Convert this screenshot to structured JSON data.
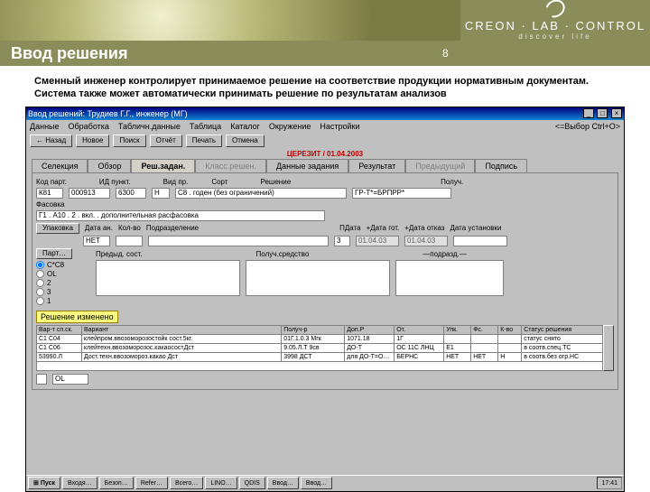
{
  "slide": {
    "title": "Ввод решения",
    "page": "8",
    "desc": "Сменный инженер контролирует принимаемое решение на соответствие продукции нормативным документам. Система также может автоматически принимать решение по результатам анализов"
  },
  "brand": {
    "name": "CREON · LAB · CONTROL",
    "tag": "discover life"
  },
  "app": {
    "title": "Ввод решений: Трудиев Г.Г., инженер (МГ)",
    "menu": [
      "Данные",
      "Обработка",
      "Табличн.данные",
      "Таблица",
      "Каталог",
      "Окружение",
      "Настройки"
    ],
    "toolbar_right": "<=Выбор Ctrl+O>",
    "toolbar": [
      "← Назад",
      "Новое",
      "Поиск",
      "Отчёт",
      "Печать",
      "Отмена"
    ],
    "redline": "ЦЕРЕЗИТ / 01.04.2003",
    "tabs": [
      "Селекция",
      "Обзор",
      "Реш.задан.",
      "Класс.решен.",
      "Данные задания",
      "Результат",
      "Предыдущий",
      "Подпись"
    ],
    "sel": {
      "labels": {
        "kodpart": "Код парт.",
        "idpyt": "ИД пункт.",
        "vidpo": "Вид пр.",
        "sort": "Сорт",
        "reshenie": "Решение",
        "poluch": "Получ."
      },
      "kodpart": "К81",
      "idpyt": "000913",
      "vidpo": "6300",
      "sort": "Н",
      "reshenie": "С8 . годен (без ограничений)",
      "poluch": "ГР-Т*=БРПРР*"
    },
    "fasovka_label": "Фасовка",
    "fasovka_val": "Г1 . А10 . 2 . вкл. . дополнительная расфасовка",
    "blk": {
      "labels": {
        "upak": "Упаковка",
        "dataan": "Дата ан.",
        "kolvo": "Кол-во",
        "podr": "Подразделение",
        "pdata": "ПДата",
        "datagot": "+Дата гот.",
        "dataotk": "+Дата отказ",
        "dataust": "Дата установки"
      },
      "dataan": "НЕТ",
      "pdata": "3",
      "datagot": "01.04.03",
      "dataotk": "01.04.03"
    },
    "cols": {
      "prev": "Предыд. сост.",
      "poluchsr": "Получ.средство",
      "podr": "—подразд.—"
    },
    "part_lbl": "Парт…",
    "radio": [
      "С*С8",
      "OL",
      "2",
      "3",
      "1"
    ],
    "yellow": "Решение изменено",
    "tbl": {
      "head": [
        "Вар-т сп.ск.",
        "Вариант",
        "Получ-р",
        "Доп.Р",
        "От.",
        "Упк.",
        "Фс.",
        "К-во",
        "Статус решения"
      ],
      "rows": [
        [
          "С1 С04",
          "клейпром.ввозоморозостойк сост.5кг.",
          "01Г.1.0.3 Мгк",
          "1071.18",
          "1Г",
          "",
          "",
          "",
          "статус снято"
        ],
        [
          "С1 С06",
          "клейтехн.ввозоморозос.какаосостДст",
          "9.05.Л.Т 9св",
          "ДО-Т",
          "ОС 11С ЛНЦ",
          "Е1",
          "",
          "",
          "в соотв.спец.ТС"
        ],
        [
          "53990.Л",
          "Дост.техн.ввозомороз.какао Дст",
          "3998 ДСТ",
          "для ДО-Т=ОС-Т",
          "БЕРНС",
          "НЕТ",
          "НЕТ",
          "Н",
          "в соотв.без огр.НС"
        ]
      ]
    },
    "bottom_sel": "OL"
  },
  "taskbar": {
    "start": "Пуск",
    "items": [
      "Входя…",
      "Безоп…",
      "Refer…",
      "Всего…",
      "LINO…",
      "QDIS",
      "Ввод…",
      "Ввод…"
    ],
    "clock": "17:41"
  }
}
